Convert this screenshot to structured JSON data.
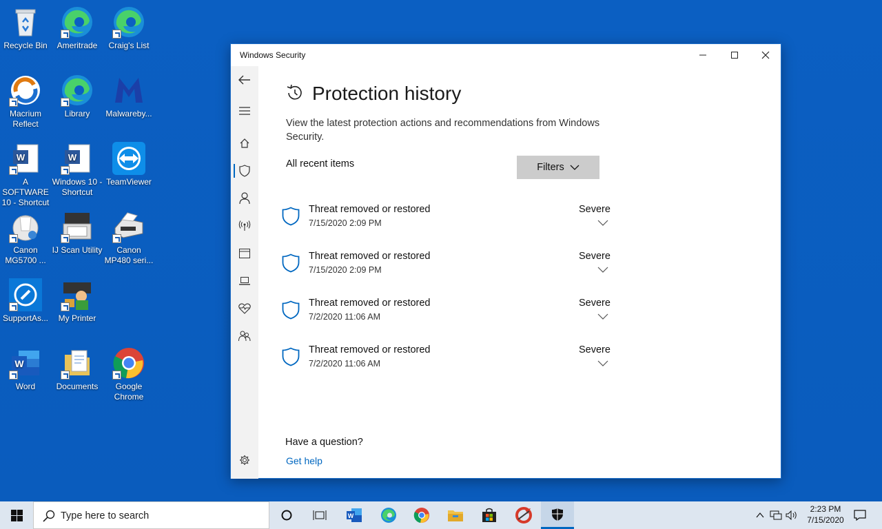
{
  "desktop": {
    "icons": [
      {
        "label": "Recycle Bin",
        "icon": "recycle-bin-icon"
      },
      {
        "label": "Ameritrade",
        "icon": "edge-icon"
      },
      {
        "label": "Craig's List",
        "icon": "edge-icon"
      },
      {
        "label": "Macrium Reflect",
        "icon": "macrium-icon"
      },
      {
        "label": "Library",
        "icon": "edge-icon"
      },
      {
        "label": "Malwareby...",
        "icon": "malwarebytes-icon"
      },
      {
        "label": "A SOFTWARE 10 - Shortcut",
        "icon": "word-doc-icon"
      },
      {
        "label": "Windows 10 - Shortcut",
        "icon": "word-doc-icon"
      },
      {
        "label": "TeamViewer",
        "icon": "teamviewer-icon"
      },
      {
        "label": "Canon MG5700 ...",
        "icon": "canon-icon"
      },
      {
        "label": "IJ Scan Utility",
        "icon": "scanner-icon"
      },
      {
        "label": "Canon MP480 seri...",
        "icon": "printer-icon"
      },
      {
        "label": "SupportAs...",
        "icon": "supportassist-icon"
      },
      {
        "label": "My Printer",
        "icon": "my-printer-icon"
      },
      {
        "label": "Word",
        "icon": "word-icon"
      },
      {
        "label": "Documents",
        "icon": "documents-folder-icon"
      },
      {
        "label": "Google Chrome",
        "icon": "chrome-icon"
      }
    ]
  },
  "window": {
    "title": "Windows Security",
    "page_title": "Protection history",
    "description": "View the latest protection actions and recommendations from Windows Security.",
    "recent_label": "All recent items",
    "filters_label": "Filters",
    "threats": [
      {
        "title": "Threat removed or restored",
        "date": "7/15/2020 2:09 PM",
        "severity": "Severe"
      },
      {
        "title": "Threat removed or restored",
        "date": "7/15/2020 2:09 PM",
        "severity": "Severe"
      },
      {
        "title": "Threat removed or restored",
        "date": "7/2/2020 11:06 AM",
        "severity": "Severe"
      },
      {
        "title": "Threat removed or restored",
        "date": "7/2/2020 11:06 AM",
        "severity": "Severe"
      }
    ],
    "question": "Have a question?",
    "get_help": "Get help"
  },
  "taskbar": {
    "search_placeholder": "Type here to search",
    "time": "2:23 PM",
    "date": "7/15/2020"
  },
  "colors": {
    "desktop": "#0a5ec0",
    "accent": "#0067c0",
    "taskbar": "#dde6f0"
  }
}
